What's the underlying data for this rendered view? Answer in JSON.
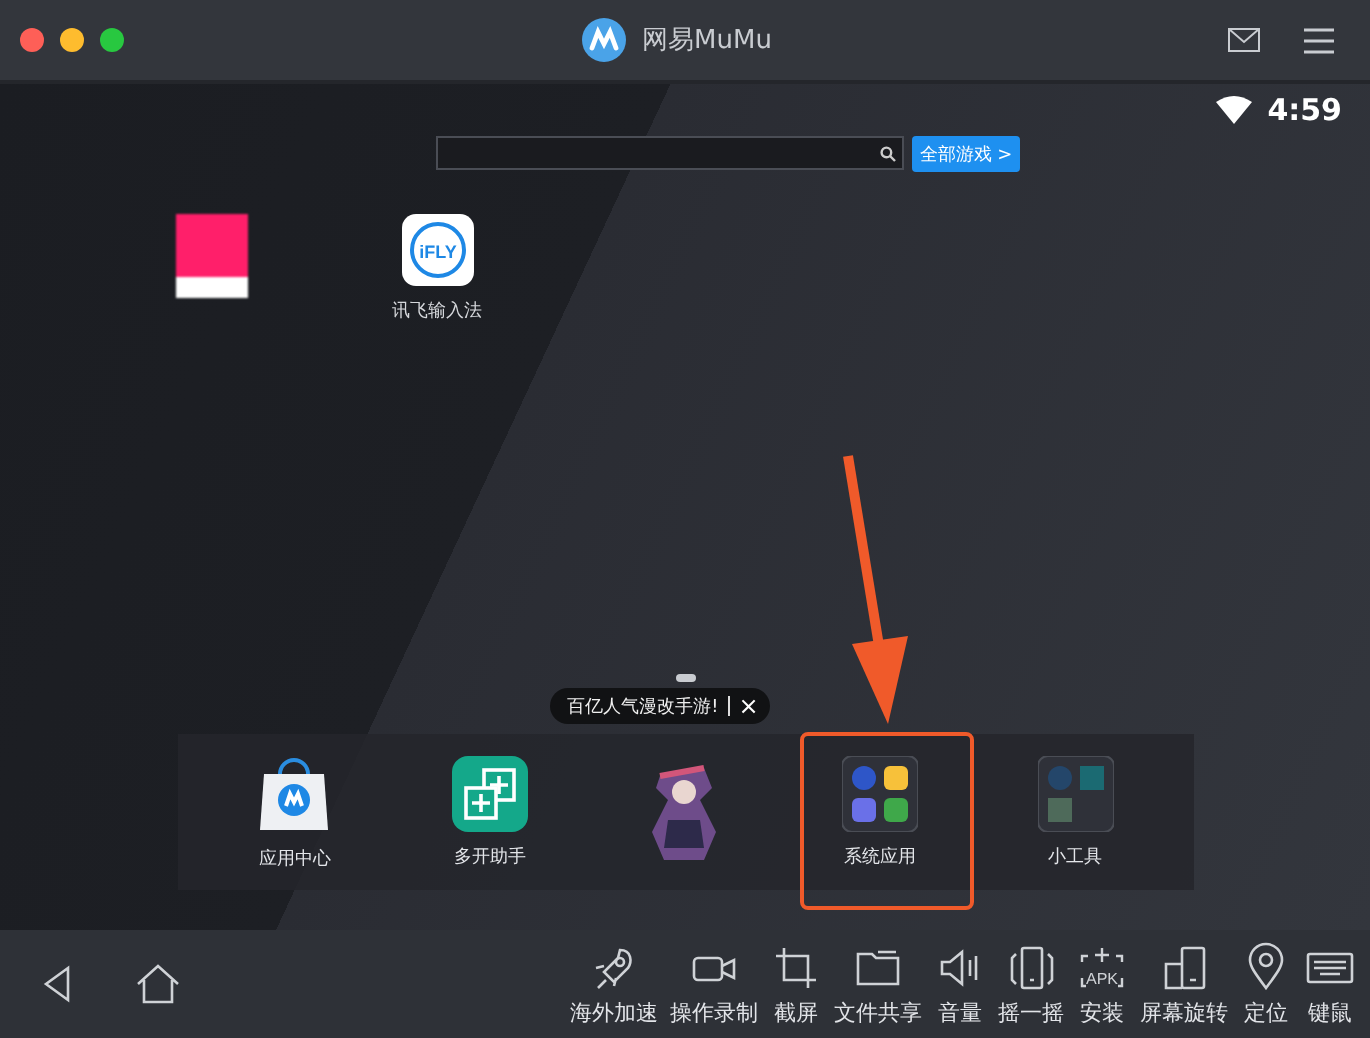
{
  "window": {
    "title": "网易MuMu"
  },
  "status": {
    "time": "4:59"
  },
  "search": {
    "button": "全部游戏 >"
  },
  "desktop_apps": [
    {
      "kind": "blurred"
    },
    {
      "kind": "ifly",
      "label": "讯飞输入法",
      "icon_text": "iFLY"
    }
  ],
  "tooltip": {
    "text": "百亿人气漫改手游!",
    "close": "×"
  },
  "dock": [
    {
      "kind": "store",
      "label": "应用中心",
      "annotated": false
    },
    {
      "kind": "multi",
      "label": "多开助手",
      "annotated": false
    },
    {
      "kind": "game",
      "annotated": false
    },
    {
      "kind": "system",
      "label": "系统应用",
      "annotated": true
    },
    {
      "kind": "tools",
      "label": "小工具",
      "annotated": false
    }
  ],
  "toolbar": [
    {
      "kind": "back"
    },
    {
      "kind": "home"
    },
    {
      "kind": "rocket",
      "label": "海外加速"
    },
    {
      "kind": "camera",
      "label": "操作录制"
    },
    {
      "kind": "crop",
      "label": "截屏"
    },
    {
      "kind": "folder",
      "label": "文件共享"
    },
    {
      "kind": "volume",
      "label": "音量"
    },
    {
      "kind": "shake",
      "label": "摇一摇"
    },
    {
      "kind": "apk",
      "label": "安装",
      "icon_text": "APK"
    },
    {
      "kind": "rotate",
      "label": "屏幕旋转"
    },
    {
      "kind": "pin",
      "label": "定位"
    },
    {
      "kind": "keyboard",
      "label": "键鼠"
    }
  ]
}
